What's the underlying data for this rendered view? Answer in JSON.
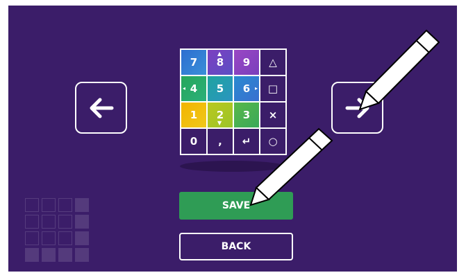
{
  "nav": {
    "left_icon": "arrow-left-icon",
    "right_icon": "arrow-right-icon"
  },
  "keypad": {
    "rows": [
      [
        "7",
        "8",
        "9",
        "△"
      ],
      [
        "4",
        "5",
        "6",
        "□"
      ],
      [
        "1",
        "2",
        "3",
        "×"
      ],
      [
        "0",
        ",",
        "↵",
        "○"
      ]
    ],
    "hints": {
      "up": "▲",
      "down": "▼",
      "left": "◂",
      "right": "▸"
    }
  },
  "buttons": {
    "save_label": "SAVE",
    "back_label": "BACK"
  },
  "colors": {
    "background": "#3b1d69",
    "save_green": "#2f9c55"
  }
}
